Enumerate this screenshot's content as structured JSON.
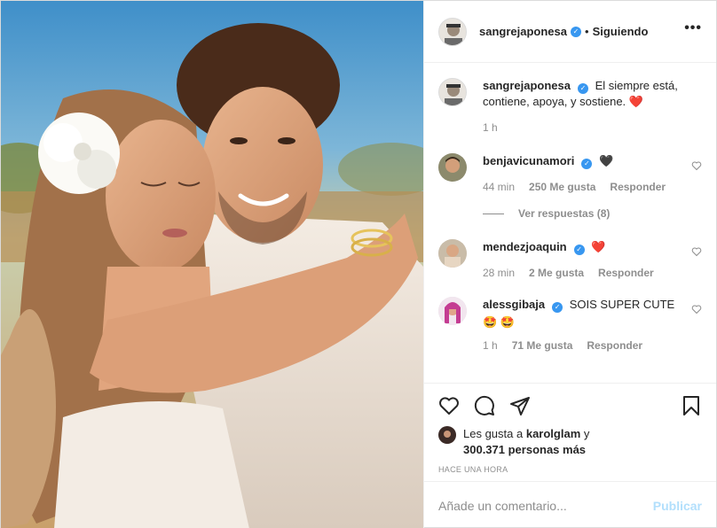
{
  "post": {
    "author": "sangrejaponesa",
    "follow_separator": "•",
    "follow_status": "Siguiendo",
    "more_label": "•••"
  },
  "caption": {
    "username": "sangrejaponesa",
    "text": "El siempre está, contiene, apoya, y sostiene.",
    "emoji": "❤️",
    "time": "1 h"
  },
  "comments": [
    {
      "username": "benjavicunamori",
      "text": "🖤",
      "time": "44 min",
      "likes": "250 Me gusta",
      "reply": "Responder",
      "verified": true
    },
    {
      "username": "mendezjoaquin",
      "text": "❤️",
      "time": "28 min",
      "likes": "2 Me gusta",
      "reply": "Responder",
      "verified": true
    },
    {
      "username": "alessgibaja",
      "text": "SOIS SUPER CUTE",
      "text2": "🤩 🤩",
      "time": "1 h",
      "likes": "71 Me gusta",
      "reply": "Responder",
      "verified": true
    }
  ],
  "view_replies": "Ver respuestas (8)",
  "likes_line": {
    "prefix": "Les gusta a",
    "user": "karolglam",
    "and": "y",
    "count": "300.371 personas más"
  },
  "time_ago": "HACE UNA HORA",
  "add_comment": {
    "placeholder": "Añade un comentario...",
    "publish": "Publicar"
  },
  "icons": {
    "verified": "✓",
    "like": "heart-icon",
    "comment": "comment-icon",
    "share": "share-icon",
    "save": "bookmark-icon"
  },
  "colors": {
    "verified_blue": "#3897f0",
    "publish_disabled": "#b2dffc",
    "heart_red": "#ed4956"
  }
}
